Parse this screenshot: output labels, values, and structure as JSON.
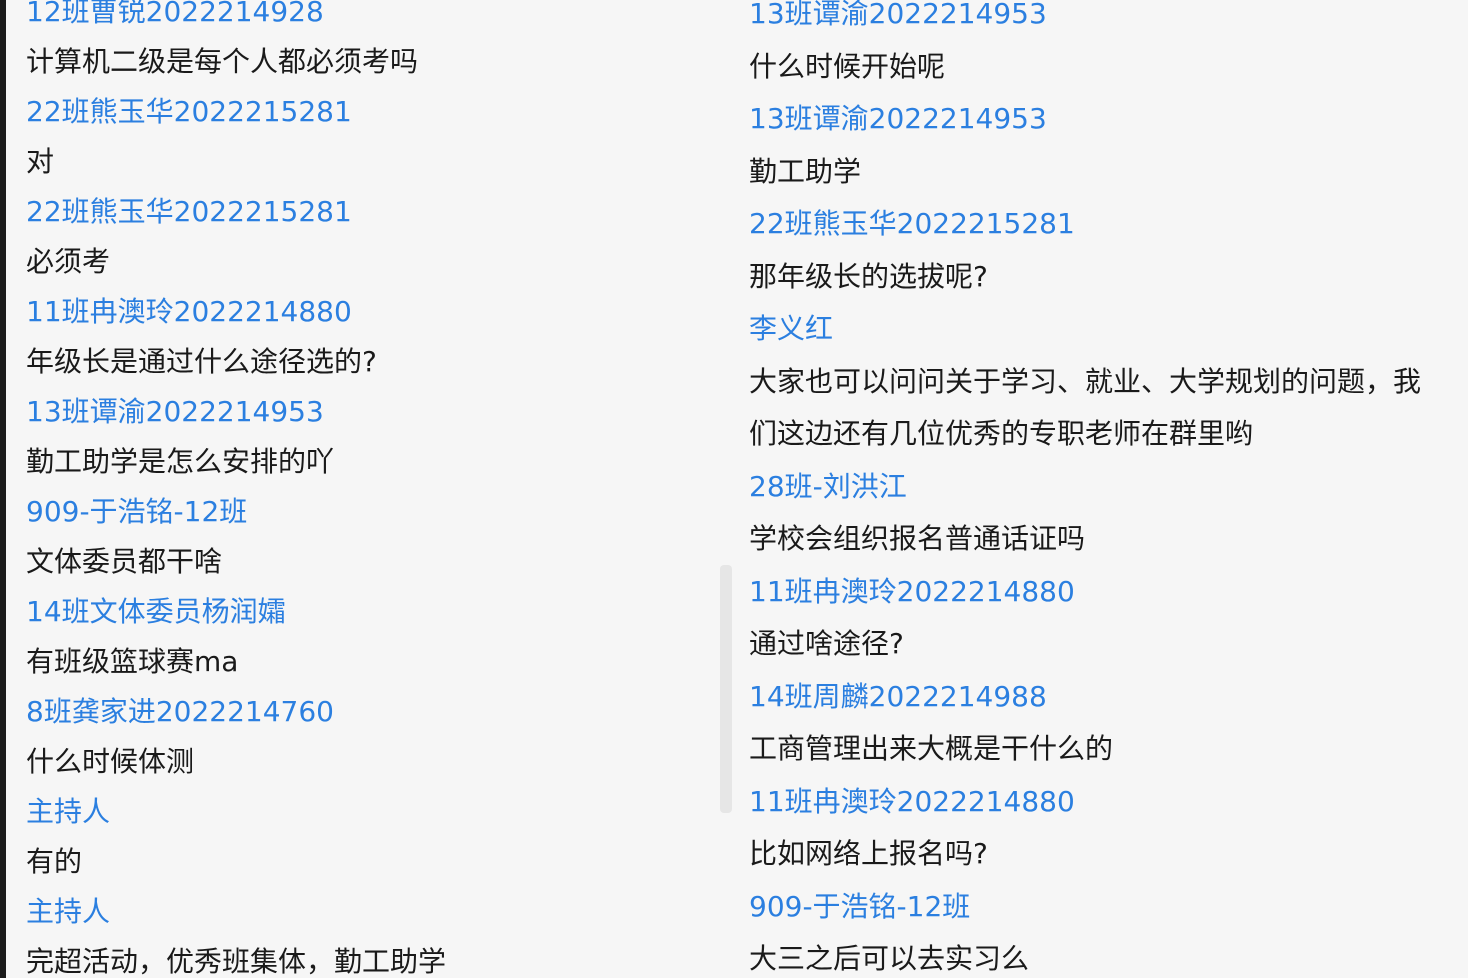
{
  "left_column": [
    {
      "sender": "12班曹锐2022214928",
      "message": "计算机二级是每个人都必须考吗"
    },
    {
      "sender": "22班熊玉华2022215281",
      "message": "对"
    },
    {
      "sender": "22班熊玉华2022215281",
      "message": "必须考"
    },
    {
      "sender": "11班冉澳玲2022214880",
      "message": "年级长是通过什么途径选的?"
    },
    {
      "sender": "13班谭渝2022214953",
      "message": "勤工助学是怎么安排的吖"
    },
    {
      "sender": "909-于浩铭-12班",
      "message": "文体委员都干啥"
    },
    {
      "sender": "14班文体委员杨润孀",
      "message": "有班级篮球赛ma"
    },
    {
      "sender": "8班龚家进2022214760",
      "message": "什么时候体测"
    },
    {
      "sender": "主持人",
      "message": "有的"
    },
    {
      "sender": "主持人",
      "message": "完超活动，优秀班集体，勤工助学"
    }
  ],
  "right_column": [
    {
      "sender": "13班谭渝2022214953",
      "message": "什么时候开始呢"
    },
    {
      "sender": "13班谭渝2022214953",
      "message": "勤工助学"
    },
    {
      "sender": "22班熊玉华2022215281",
      "message": "那年级长的选拔呢?"
    },
    {
      "sender": "李义红",
      "message": "大家也可以问问关于学习、就业、大学规划的问题，我",
      "message_cont": "们这边还有几位优秀的专职老师在群里哟"
    },
    {
      "sender": "28班-刘洪江",
      "message": "学校会组织报名普通话证吗"
    },
    {
      "sender": "11班冉澳玲2022214880",
      "message": "通过啥途径?"
    },
    {
      "sender": "14班周麟2022214988",
      "message": "工商管理出来大概是干什么的"
    },
    {
      "sender": "11班冉澳玲2022214880",
      "message": "比如网络上报名吗?"
    },
    {
      "sender": "909-于浩铭-12班",
      "message": "大三之后可以去实习么"
    }
  ],
  "colors": {
    "sender_name": "#2b7fe0",
    "message_text": "#1a1a1a",
    "background": "#f6f6f6"
  }
}
